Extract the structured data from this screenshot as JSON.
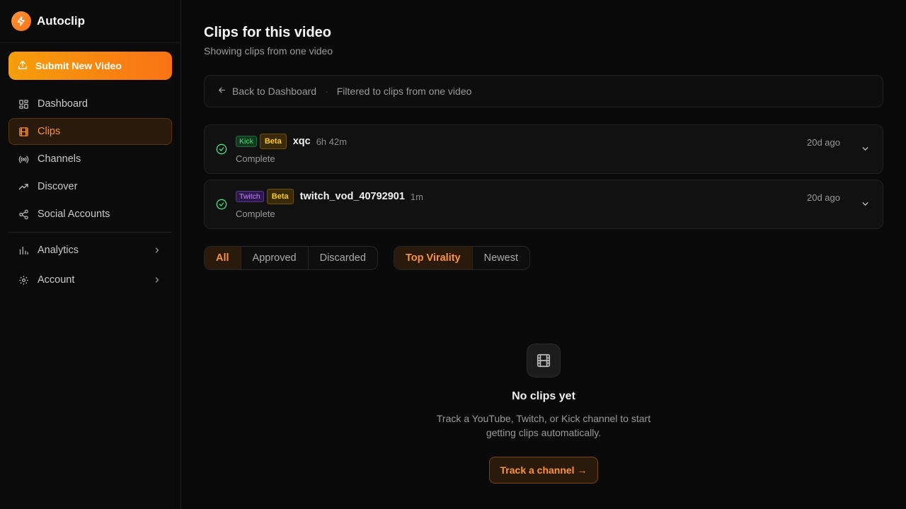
{
  "app": {
    "name": "Autoclip"
  },
  "sidebar": {
    "submit_label": "Submit New Video",
    "items": [
      {
        "label": "Dashboard",
        "icon": "dashboard-icon"
      },
      {
        "label": "Clips",
        "icon": "film-icon",
        "active": true
      },
      {
        "label": "Channels",
        "icon": "broadcast-icon"
      },
      {
        "label": "Discover",
        "icon": "trending-icon"
      },
      {
        "label": "Social Accounts",
        "icon": "share-icon"
      }
    ],
    "groups": [
      {
        "label": "Analytics",
        "icon": "bar-chart-icon"
      },
      {
        "label": "Account",
        "icon": "gear-icon"
      }
    ]
  },
  "header": {
    "title": "Clips for this video",
    "subtitle": "Showing clips from one video"
  },
  "filter_bar": {
    "back_label": "Back to Dashboard",
    "separator": "·",
    "filter_text": "Filtered to clips from one video"
  },
  "videos": [
    {
      "platform": "Kick",
      "beta": "Beta",
      "title": "xqc",
      "duration": "6h 42m",
      "status": "Complete",
      "age": "20d ago"
    },
    {
      "platform": "Twitch",
      "beta": "Beta",
      "title": "twitch_vod_40792901",
      "duration": "1m",
      "status": "Complete",
      "age": "20d ago"
    }
  ],
  "status_filter": {
    "all": "All",
    "approved": "Approved",
    "discarded": "Discarded",
    "selected": "All"
  },
  "sort": {
    "top": "Top Virality",
    "newest": "Newest",
    "selected": "Top Virality"
  },
  "empty_state": {
    "title": "No clips yet",
    "description": "Track a YouTube, Twitch, or Kick channel to start getting clips automatically.",
    "cta": "Track a channel →"
  },
  "colors": {
    "accent": "#f97316",
    "success": "#4ade80",
    "background": "#0a0a0a"
  }
}
